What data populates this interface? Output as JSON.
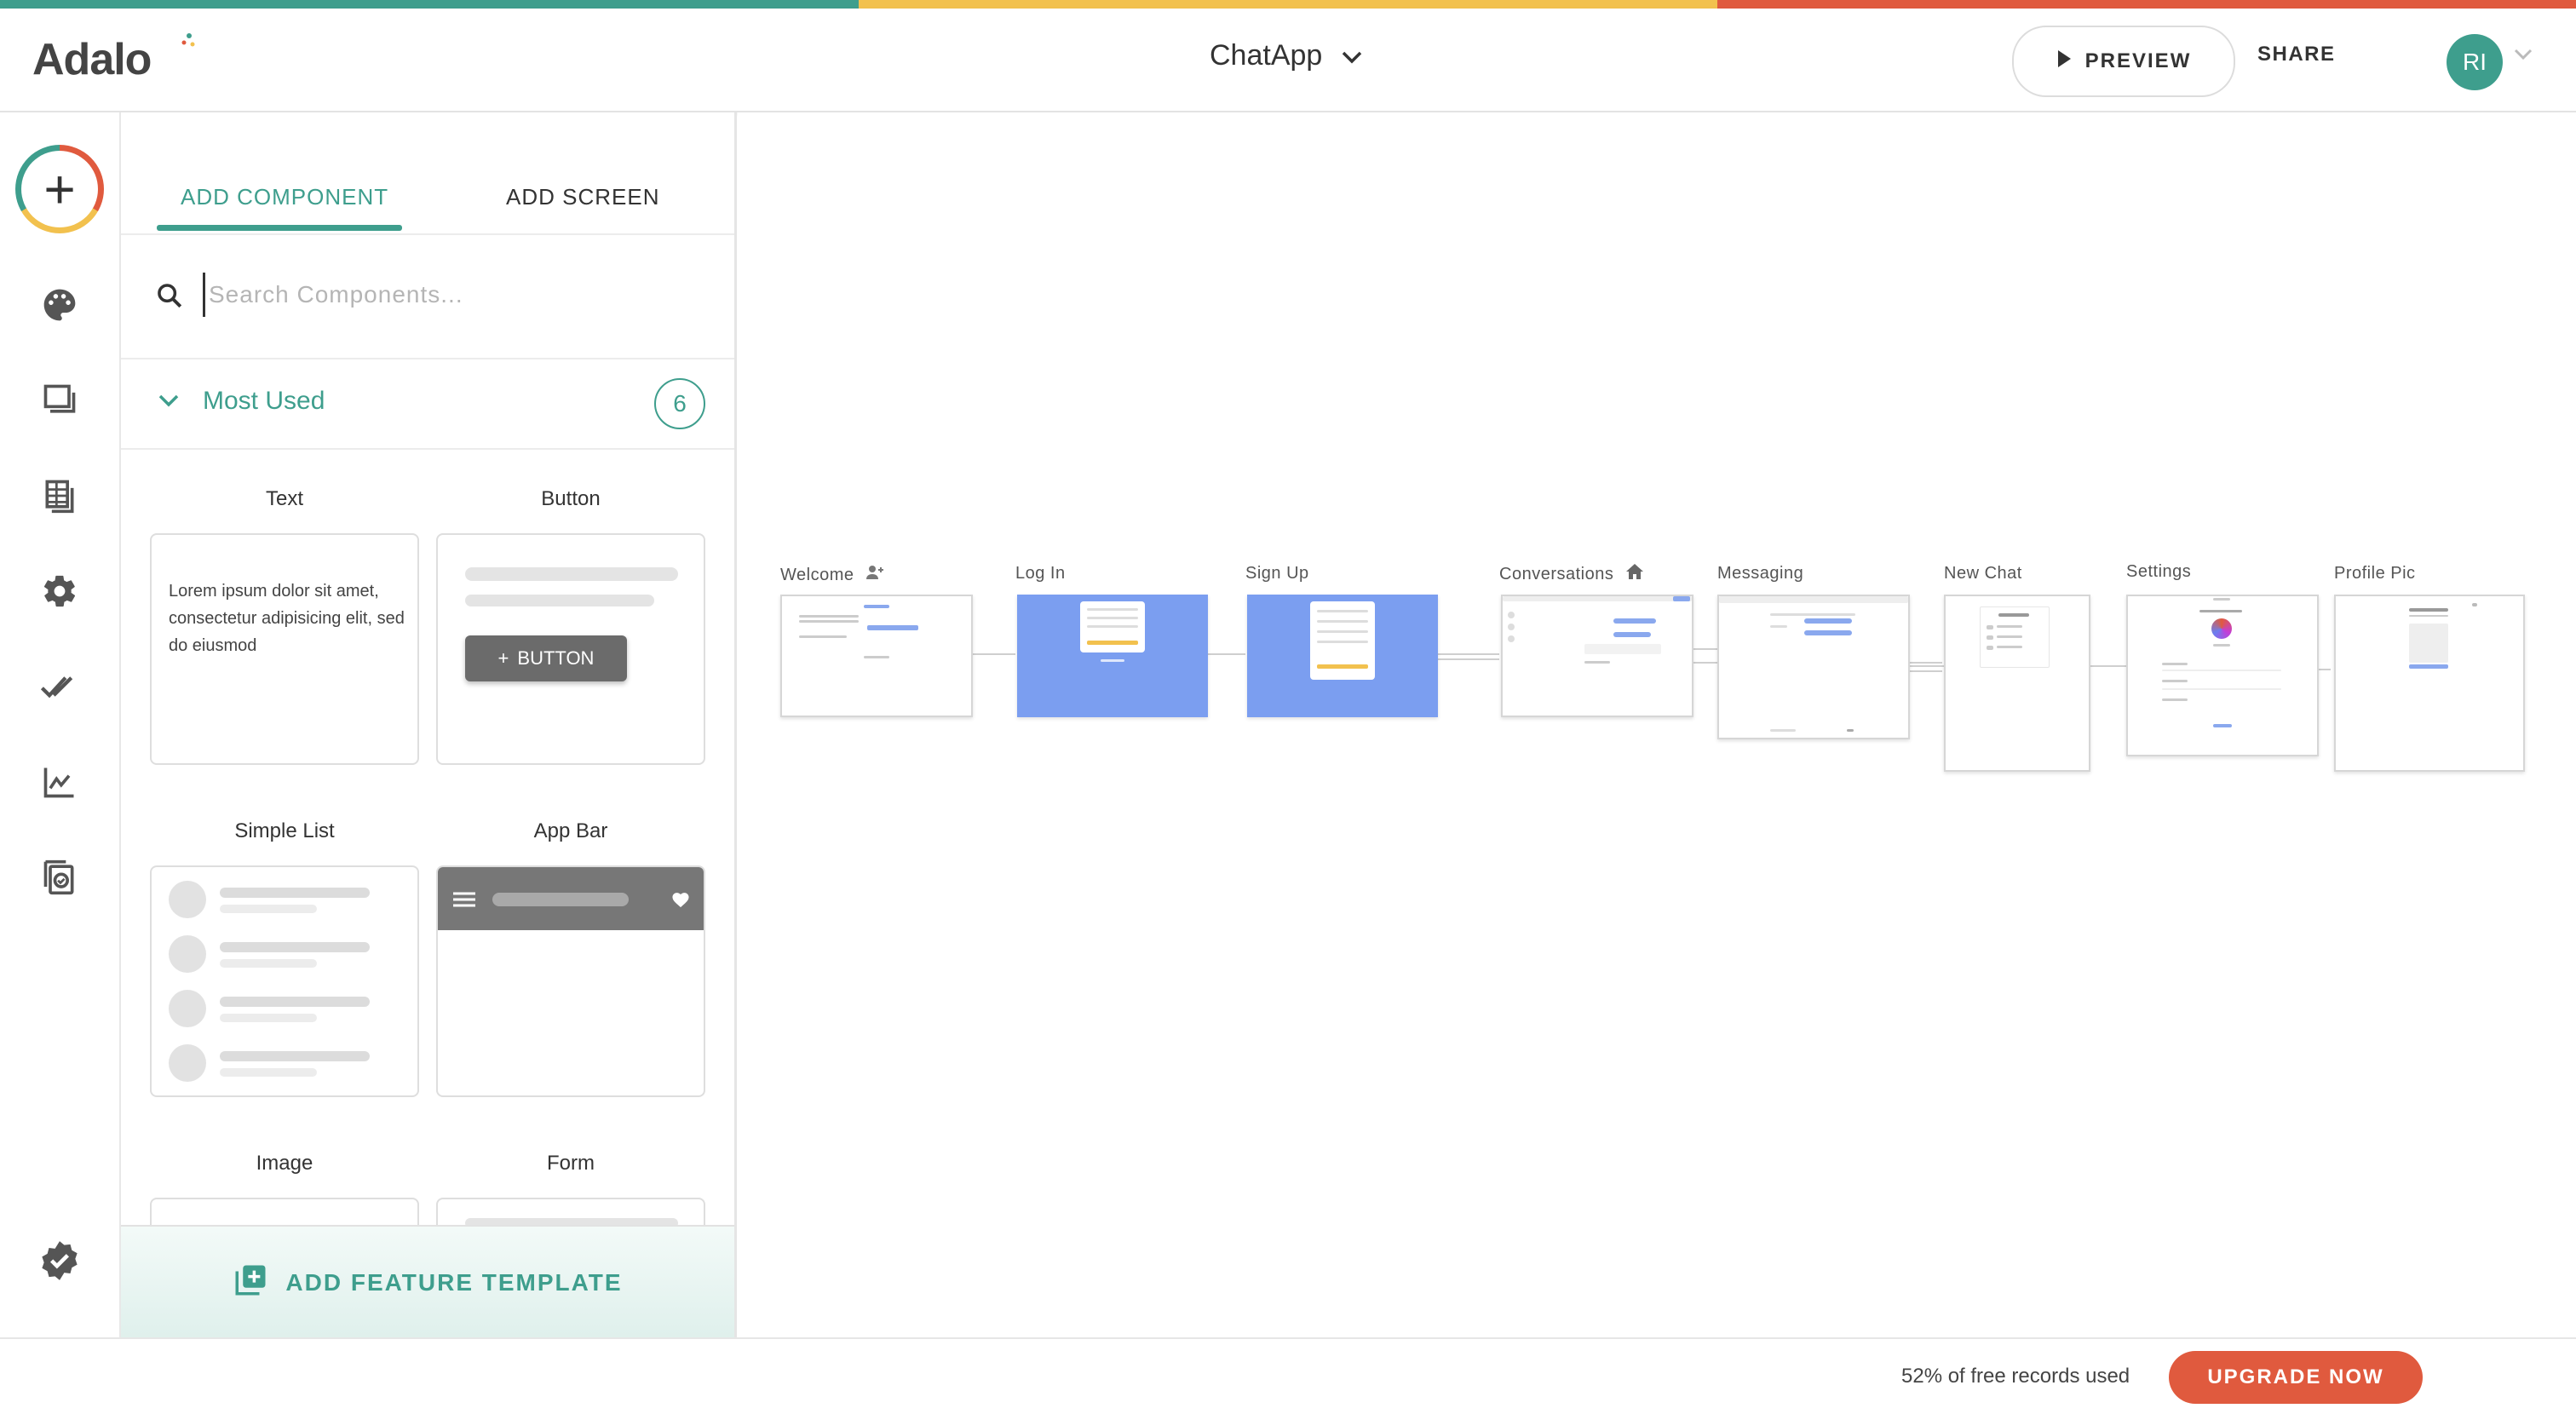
{
  "colors": {
    "teal": "#3e9e8d",
    "yellow": "#f2c14e",
    "red": "#e05a3e",
    "screen_blue": "#7b9ef0"
  },
  "header": {
    "logo": "Adalo",
    "app_name": "ChatApp",
    "preview_label": "PREVIEW",
    "share_label": "SHARE",
    "avatar_initials": "RI"
  },
  "rail": {
    "icons": [
      "add-icon",
      "palette-icon",
      "screens-icon",
      "database-icon",
      "gear-icon",
      "checkmarks-icon",
      "analytics-icon",
      "publish-icon",
      "verified-badge-icon"
    ]
  },
  "panel": {
    "tabs": [
      {
        "label": "ADD COMPONENT",
        "active": true
      },
      {
        "label": "ADD SCREEN",
        "active": false
      }
    ],
    "search_placeholder": "Search Components...",
    "section": {
      "label": "Most Used",
      "count": "6"
    },
    "components": [
      {
        "label": "Text",
        "preview_text": "Lorem ipsum dolor sit amet, consectetur adipisicing elit, sed do eiusmod"
      },
      {
        "label": "Button",
        "preview_text": "BUTTON"
      },
      {
        "label": "Simple List"
      },
      {
        "label": "App Bar"
      },
      {
        "label": "Image"
      },
      {
        "label": "Form"
      }
    ],
    "feature_template_label": "ADD FEATURE TEMPLATE"
  },
  "canvas": {
    "screens": [
      {
        "name": "Welcome",
        "icon": "person-add-icon"
      },
      {
        "name": "Log In",
        "mini_title": "Chat App"
      },
      {
        "name": "Sign Up",
        "mini_title": "Chat App"
      },
      {
        "name": "Conversations",
        "icon": "home-icon"
      },
      {
        "name": "Messaging"
      },
      {
        "name": "New Chat",
        "mini_title": "New Chat"
      },
      {
        "name": "Settings"
      },
      {
        "name": "Profile Pic",
        "mini_title": "Add a pic"
      }
    ]
  },
  "footer": {
    "records_text": "52% of free records used",
    "upgrade_label": "UPGRADE NOW"
  }
}
